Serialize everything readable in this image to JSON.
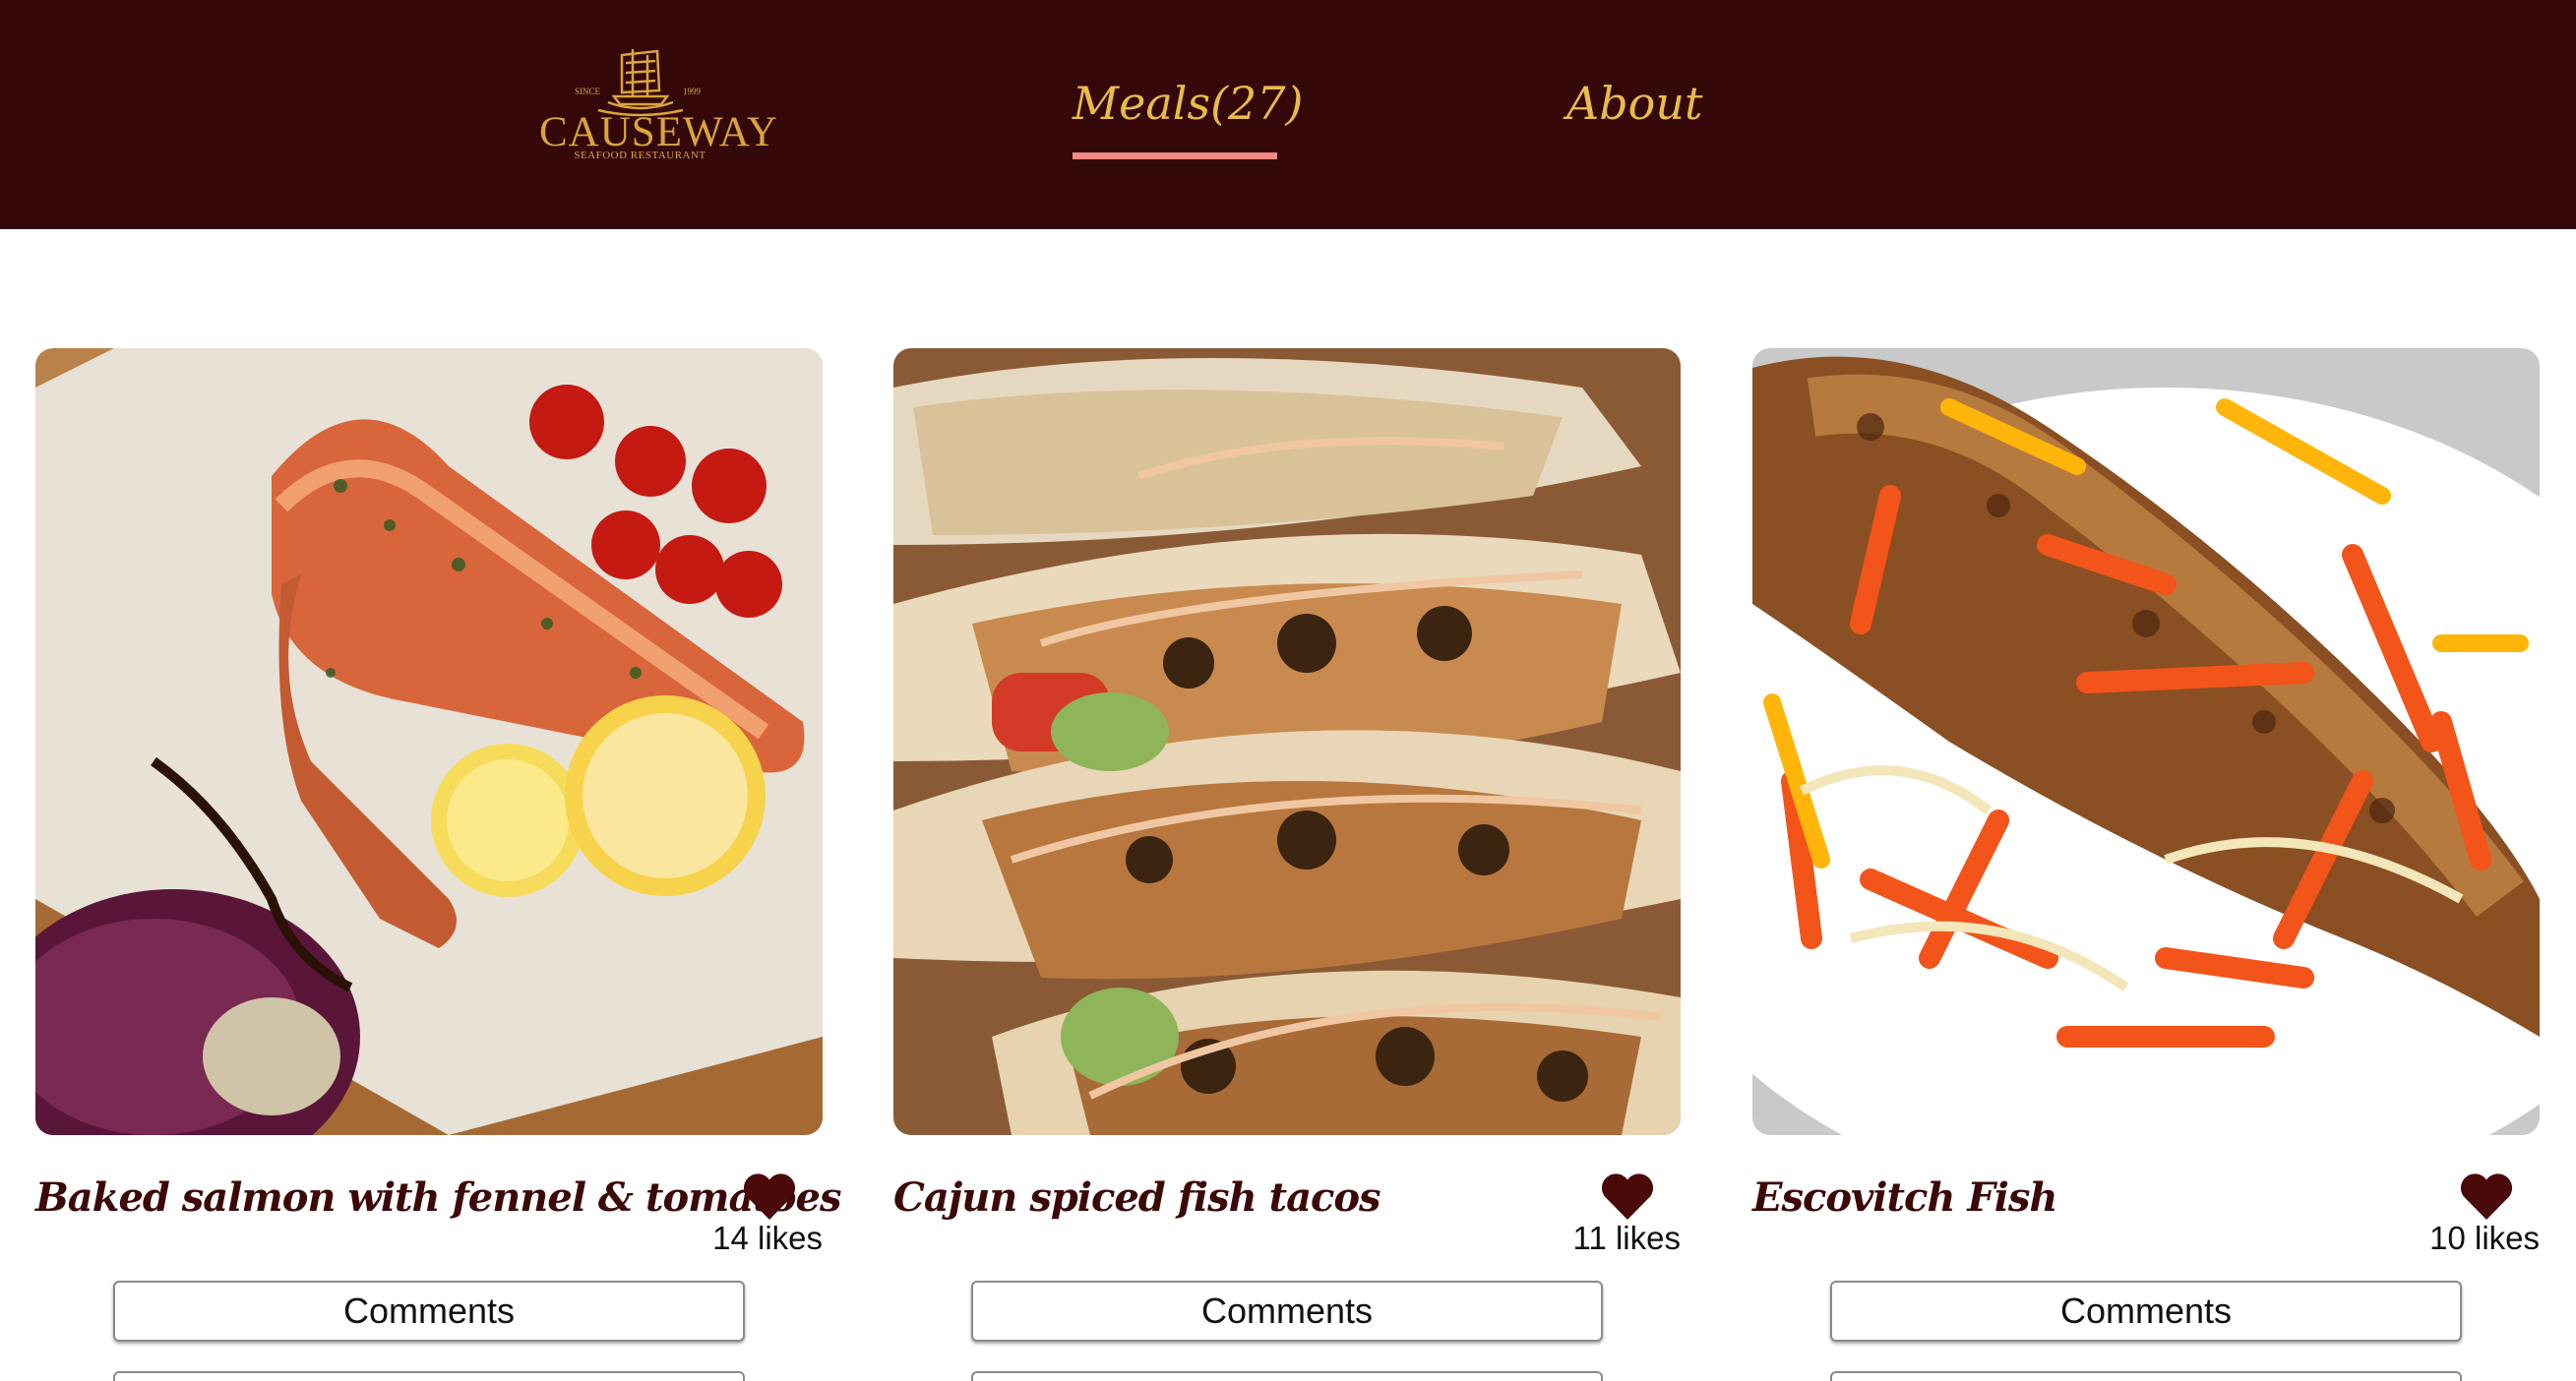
{
  "header": {
    "logo": {
      "since": "SINCE",
      "year": "1999",
      "name": "CAUSEWAY",
      "subtitle": "SEAFOOD RESTAURANT"
    },
    "nav": [
      {
        "label": "Meals(27)",
        "active": true
      },
      {
        "label": "About",
        "active": false
      }
    ],
    "accent_color": "#f08a84",
    "background_color": "#340808",
    "link_color": "#e8bb4a"
  },
  "meals": [
    {
      "title": "Baked salmon with fennel & tomatoes",
      "likes": "14 likes",
      "comments_label": "Comments",
      "image": "salmon-fillet-photo"
    },
    {
      "title": "Cajun spiced fish tacos",
      "likes": "11 likes",
      "comments_label": "Comments",
      "image": "fish-tacos-photo"
    },
    {
      "title": "Escovitch Fish",
      "likes": "10 likes",
      "comments_label": "Comments",
      "image": "escovitch-fish-photo"
    }
  ]
}
